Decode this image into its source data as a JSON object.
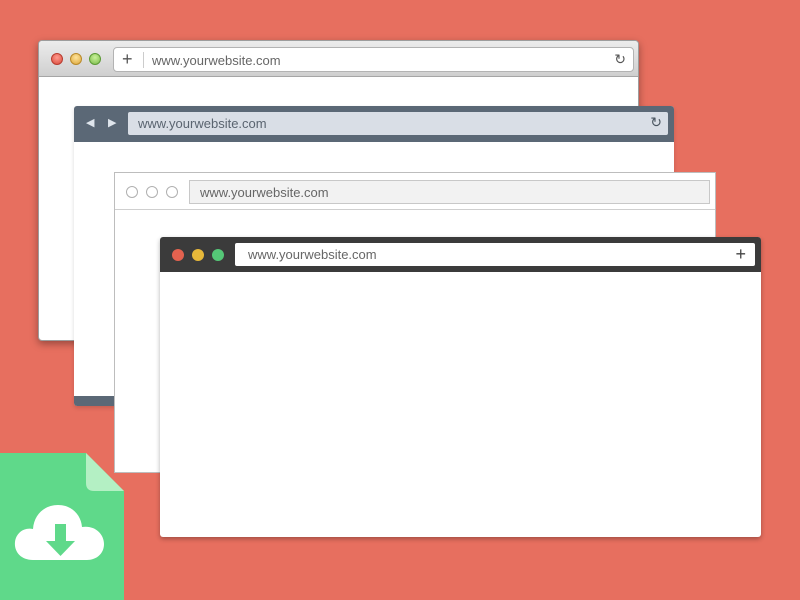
{
  "browsers": [
    {
      "url": "www.yourwebsite.com"
    },
    {
      "url": "www.yourwebsite.com"
    },
    {
      "url": "www.yourwebsite.com"
    },
    {
      "url": "www.yourwebsite.com"
    }
  ],
  "colors": {
    "background": "#e76f5f",
    "file_icon": "#5fd98a",
    "dark_bar": "#3b3b3b",
    "slate_bar": "#5b6876"
  },
  "icons": {
    "file": "download-file-icon",
    "cloud": "cloud-download-icon",
    "plus": "plus-icon",
    "reload": "reload-icon",
    "back": "back-arrow-icon",
    "forward": "forward-arrow-icon"
  }
}
